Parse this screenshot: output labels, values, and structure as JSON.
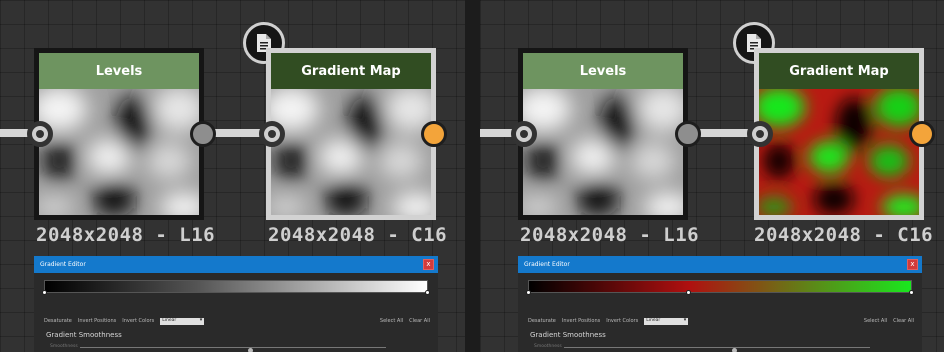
{
  "left_panel": {
    "levels_node": {
      "title": "Levels",
      "resolution": "2048x2048 - L16"
    },
    "gradient_node": {
      "title": "Gradient Map",
      "resolution": "2048x2048 - C16"
    },
    "gradient_editor": {
      "title": "Gradient Editor",
      "close_label": "x",
      "desaturate": "Desaturate",
      "invert_positions": "Invert Positions",
      "invert_colors": "Invert Colors",
      "interpolation": "Linear",
      "select_all": "Select All",
      "clear_all": "Clear All",
      "smoothness_label": "Gradient Smoothness",
      "slider_label": "Smoothness"
    }
  },
  "right_panel": {
    "levels_node": {
      "title": "Levels",
      "resolution": "2048x2048 - L16"
    },
    "gradient_node": {
      "title": "Gradient Map",
      "resolution": "2048x2048 - C16"
    },
    "gradient_editor": {
      "title": "Gradient Editor",
      "close_label": "x",
      "desaturate": "Desaturate",
      "invert_positions": "Invert Positions",
      "invert_colors": "Invert Colors",
      "interpolation": "Linear",
      "select_all": "Select All",
      "clear_all": "Clear All",
      "smoothness_label": "Gradient Smoothness",
      "slider_label": "Smoothness"
    }
  },
  "colors": {
    "levels_header": "#6e9460",
    "gradient_header": "#314d22",
    "editor_titlebar": "#1479cc",
    "output_port": "#f3a43a",
    "map_red": "#d01e14",
    "map_green": "#19e81e"
  },
  "icons": [
    "document-icon",
    "close-icon",
    "chevron-down-icon"
  ]
}
